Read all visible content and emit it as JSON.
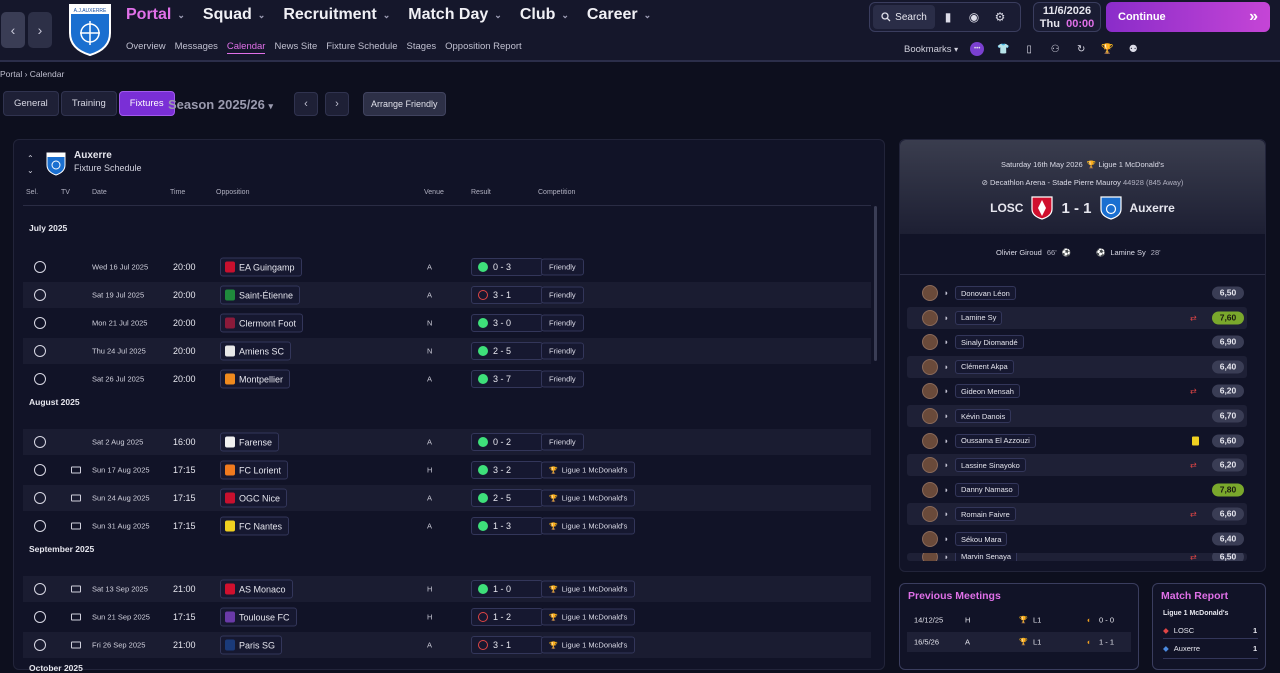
{
  "header": {
    "club_crest_text": "A.J. AUXERRE",
    "nav": [
      {
        "label": "Portal",
        "active": true
      },
      {
        "label": "Squad",
        "active": false
      },
      {
        "label": "Recruitment",
        "active": false
      },
      {
        "label": "Match Day",
        "active": false
      },
      {
        "label": "Club",
        "active": false
      },
      {
        "label": "Career",
        "active": false
      }
    ],
    "subnav": [
      {
        "label": "Overview",
        "active": false
      },
      {
        "label": "Messages",
        "active": false
      },
      {
        "label": "Calendar",
        "active": true
      },
      {
        "label": "News Site",
        "active": false
      },
      {
        "label": "Fixture Schedule",
        "active": false
      },
      {
        "label": "Stages",
        "active": false
      },
      {
        "label": "Opposition Report",
        "active": false
      }
    ],
    "search_label": "Search",
    "date": "11/6/2026",
    "day": "Thu",
    "time": "00:00",
    "continue_label": "Continue",
    "bookmarks_label": "Bookmarks"
  },
  "breadcrumb": {
    "items": [
      "Portal",
      "Calendar"
    ]
  },
  "toolbar": {
    "tabs": [
      {
        "label": "General",
        "active": false
      },
      {
        "label": "Training",
        "active": false
      },
      {
        "label": "Fixtures",
        "active": true
      }
    ],
    "season": "Season 2025/26",
    "arrange_label": "Arrange Friendly"
  },
  "fixtures": {
    "team": "Auxerre",
    "subtitle": "Fixture Schedule",
    "columns": {
      "sel": "Sel.",
      "tv": "TV",
      "date": "Date",
      "time": "Time",
      "opposition": "Opposition",
      "venue": "Venue",
      "result": "Result",
      "competition": "Competition"
    },
    "months": [
      "July 2025",
      "August 2025",
      "September 2025",
      "October 2025"
    ],
    "rows": [
      {
        "date": "Wed 16 Jul 2025",
        "time": "20:00",
        "opp": "EA Guingamp",
        "venue": "A",
        "result": "0 - 3",
        "outcome": "w",
        "comp": "Friendly",
        "tv": false,
        "badge": "#c8102e"
      },
      {
        "date": "Sat 19 Jul 2025",
        "time": "20:00",
        "opp": "Saint-Étienne",
        "venue": "A",
        "result": "3 - 1",
        "outcome": "l",
        "comp": "Friendly",
        "tv": false,
        "badge": "#1f8a3c"
      },
      {
        "date": "Mon 21 Jul 2025",
        "time": "20:00",
        "opp": "Clermont Foot",
        "venue": "N",
        "result": "3 - 0",
        "outcome": "w",
        "comp": "Friendly",
        "tv": false,
        "badge": "#8b1a3a"
      },
      {
        "date": "Thu 24 Jul 2025",
        "time": "20:00",
        "opp": "Amiens SC",
        "venue": "N",
        "result": "2 - 5",
        "outcome": "w",
        "comp": "Friendly",
        "tv": false,
        "badge": "#e8e8e8"
      },
      {
        "date": "Sat 26 Jul 2025",
        "time": "20:00",
        "opp": "Montpellier",
        "venue": "A",
        "result": "3 - 7",
        "outcome": "w",
        "comp": "Friendly",
        "tv": false,
        "badge": "#f08a1e"
      },
      {
        "date": "Sat 2 Aug 2025",
        "time": "16:00",
        "opp": "Farense",
        "venue": "A",
        "result": "0 - 2",
        "outcome": "w",
        "comp": "Friendly",
        "tv": false,
        "badge": "#f0f0f0"
      },
      {
        "date": "Sun 17 Aug 2025",
        "time": "17:15",
        "opp": "FC Lorient",
        "venue": "H",
        "result": "3 - 2",
        "outcome": "w",
        "comp": "Ligue 1 McDonald's",
        "tv": true,
        "badge": "#f07a1e"
      },
      {
        "date": "Sun 24 Aug 2025",
        "time": "17:15",
        "opp": "OGC Nice",
        "venue": "A",
        "result": "2 - 5",
        "outcome": "w",
        "comp": "Ligue 1 McDonald's",
        "tv": true,
        "badge": "#c8102e"
      },
      {
        "date": "Sun 31 Aug 2025",
        "time": "17:15",
        "opp": "FC Nantes",
        "venue": "A",
        "result": "1 - 3",
        "outcome": "w",
        "comp": "Ligue 1 McDonald's",
        "tv": true,
        "badge": "#f0d020"
      },
      {
        "date": "Sat 13 Sep 2025",
        "time": "21:00",
        "opp": "AS Monaco",
        "venue": "H",
        "result": "1 - 0",
        "outcome": "w",
        "comp": "Ligue 1 McDonald's",
        "tv": true,
        "badge": "#d0102e"
      },
      {
        "date": "Sun 21 Sep 2025",
        "time": "17:15",
        "opp": "Toulouse FC",
        "venue": "H",
        "result": "1 - 2",
        "outcome": "l",
        "comp": "Ligue 1 McDonald's",
        "tv": true,
        "badge": "#6a3aa8"
      },
      {
        "date": "Fri 26 Sep 2025",
        "time": "21:00",
        "opp": "Paris SG",
        "venue": "A",
        "result": "3 - 1",
        "outcome": "l",
        "comp": "Ligue 1 McDonald's",
        "tv": true,
        "badge": "#1a3a7a"
      }
    ]
  },
  "match": {
    "date_line": "Saturday 16th May 2026",
    "competition": "Ligue 1 McDonald's",
    "stadium": "Decathlon Arena - Stade Pierre Mauroy",
    "attendance": "44928",
    "away_fans": "(845 Away)",
    "home_team": "LOSC",
    "score": "1 - 1",
    "away_team": "Auxerre",
    "home_scorer": "Olivier Giroud",
    "home_scorer_min": "66'",
    "away_scorer": "Lamine Sy",
    "away_scorer_min": "28'",
    "players": [
      {
        "name": "Donovan Léon",
        "rating": "6,50",
        "hi": false,
        "event": ""
      },
      {
        "name": "Lamine Sy",
        "rating": "7,60",
        "hi": true,
        "event": "sub"
      },
      {
        "name": "Sinaly Diomandé",
        "rating": "6,90",
        "hi": false,
        "event": ""
      },
      {
        "name": "Clément Akpa",
        "rating": "6,40",
        "hi": false,
        "event": ""
      },
      {
        "name": "Gideon Mensah",
        "rating": "6,20",
        "hi": false,
        "event": "sub"
      },
      {
        "name": "Kévin Danois",
        "rating": "6,70",
        "hi": false,
        "event": ""
      },
      {
        "name": "Oussama El Azzouzi",
        "rating": "6,60",
        "hi": false,
        "event": "card"
      },
      {
        "name": "Lassine Sinayoko",
        "rating": "6,20",
        "hi": false,
        "event": "sub"
      },
      {
        "name": "Danny Namaso",
        "rating": "7,80",
        "hi": true,
        "event": ""
      },
      {
        "name": "Romain Faivre",
        "rating": "6,60",
        "hi": false,
        "event": "sub"
      },
      {
        "name": "Sékou Mara",
        "rating": "6,40",
        "hi": false,
        "event": ""
      },
      {
        "name": "Marvin Senaya",
        "rating": "6,50",
        "hi": false,
        "event": "sub"
      }
    ]
  },
  "previous_meetings": {
    "title": "Previous Meetings",
    "rows": [
      {
        "date": "14/12/25",
        "venue": "H",
        "comp": "L1",
        "score": "0 - 0"
      },
      {
        "date": "16/5/26",
        "venue": "A",
        "comp": "L1",
        "score": "1 - 1"
      }
    ]
  },
  "match_report": {
    "title": "Match Report",
    "competition": "Ligue 1 McDonald's",
    "teams": [
      {
        "name": "LOSC",
        "value": "1"
      },
      {
        "name": "Auxerre",
        "value": "1"
      }
    ]
  },
  "colors": {
    "accent": "#e070e8",
    "win": "#3ee07a",
    "loss": "#e04545",
    "continue": "#8a2cc9"
  }
}
